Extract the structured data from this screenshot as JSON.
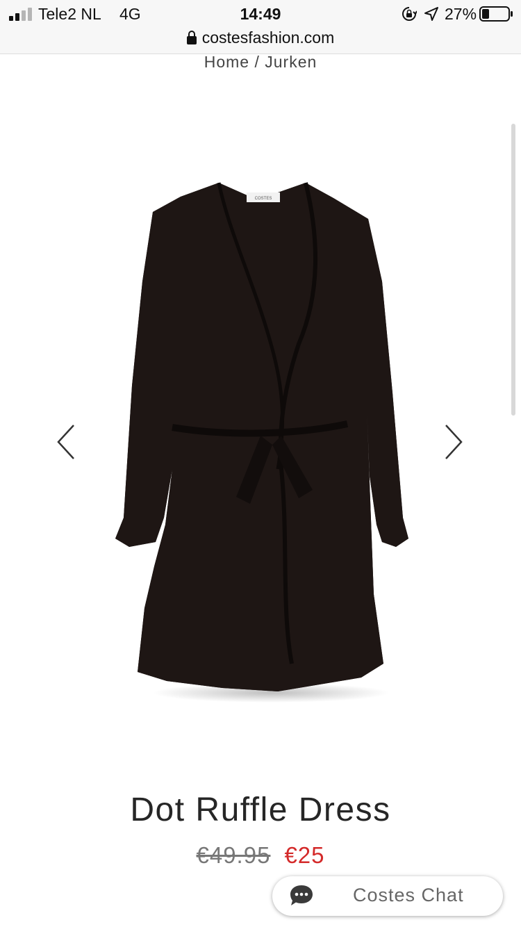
{
  "status_bar": {
    "carrier": "Tele2 NL",
    "network": "4G",
    "time": "14:49",
    "battery": "27%",
    "battery_level": 0.27
  },
  "browser": {
    "url": "costesfashion.com"
  },
  "breadcrumb": "Home / Jurken",
  "product": {
    "image_icon": "black-dot-wrap-dress-image",
    "label_text": "COSTES",
    "title": "Dot Ruffle Dress",
    "old_price": "€49.95",
    "new_price": "€25",
    "colors": {
      "sale": "#d42a2a",
      "dress": "#1e1614"
    }
  },
  "carousel": {
    "dot_count": 4,
    "active_index": 0
  },
  "chat": {
    "label": "Costes Chat",
    "icon": "chat-bubble-icon"
  }
}
